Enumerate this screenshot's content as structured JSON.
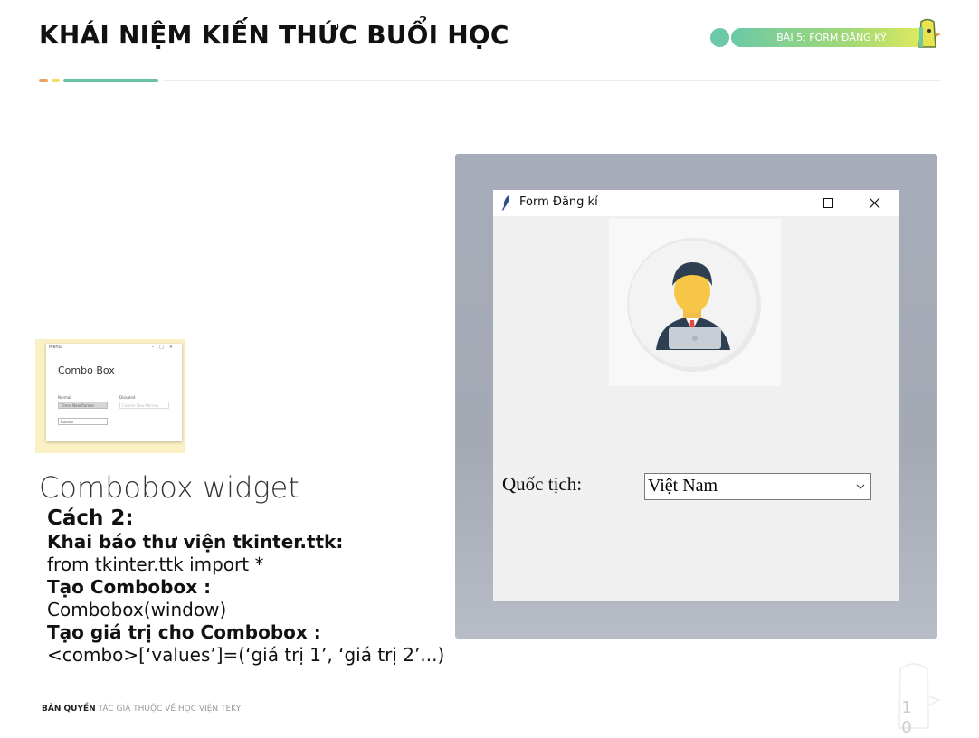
{
  "header": {
    "title": "KHÁI NIỆM KIẾN THỨC BUỔI HỌC",
    "lesson_badge": "BÀI 5: FORM ĐĂNG KÝ",
    "accent_colors": [
      "#f0a25c",
      "#f3dd63",
      "#69c3a3"
    ]
  },
  "thumbnail": {
    "window_title": "Menu",
    "heading": "Combo Box",
    "label_normal": "Normal",
    "label_disabled": "Disabled",
    "combo1_value": "Times New Roman",
    "combo2_value": "Courier New Narrow",
    "combo3_value": "Roboto"
  },
  "content": {
    "subtitle": "Combobox widget",
    "lines": [
      "Cách 2:",
      "Khai báo thư viện tkinter.ttk:",
      "from tkinter.ttk import *",
      "Tạo Combobox :",
      "Combobox(window)",
      "Tạo giá trị cho Combobox :",
      "<combo>[‘values’]=(‘giá trị 1’, ‘giá trị 2’...)"
    ]
  },
  "app_window": {
    "title": "Form Đăng kí",
    "nationality_label": "Quốc tịch:",
    "nationality_value": "Việt Nam",
    "icons": [
      "feather-icon",
      "minimize-icon",
      "maximize-icon",
      "close-icon",
      "user-avatar",
      "chevron-down-icon"
    ]
  },
  "footer": {
    "copyright_bold": "BẢN QUYỀN",
    "copyright_rest": "TÁC GIẢ THUỘC VỀ HỌC VIỆN TEKY",
    "page_number": "1\n0"
  }
}
